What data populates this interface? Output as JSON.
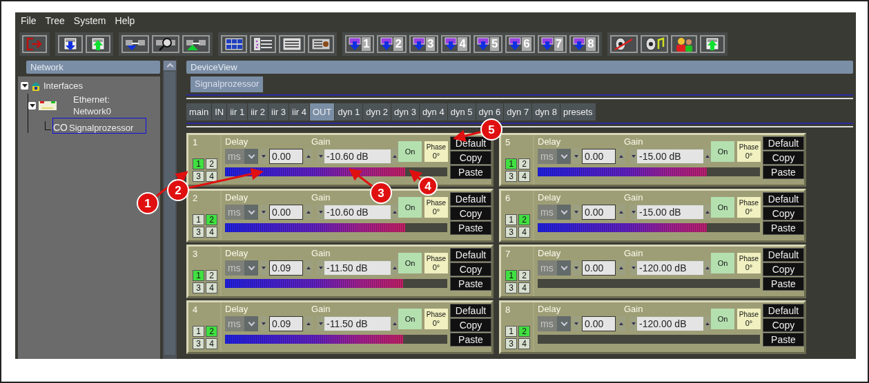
{
  "menu": [
    "File",
    "Tree",
    "System",
    "Help"
  ],
  "toolbar": [
    [
      {
        "kind": "exit"
      }
    ],
    [
      {
        "kind": "download"
      },
      {
        "kind": "upload"
      }
    ],
    [
      {
        "kind": "link-down"
      },
      {
        "kind": "link-search"
      },
      {
        "kind": "link-up"
      }
    ],
    [
      {
        "kind": "grid"
      },
      {
        "kind": "tree"
      },
      {
        "kind": "list"
      },
      {
        "kind": "device"
      }
    ],
    [
      {
        "kind": "preset",
        "label": "1"
      },
      {
        "kind": "preset",
        "label": "2"
      },
      {
        "kind": "preset",
        "label": "3"
      },
      {
        "kind": "preset",
        "label": "4"
      },
      {
        "kind": "preset",
        "label": "5"
      },
      {
        "kind": "preset",
        "label": "6"
      },
      {
        "kind": "preset",
        "label": "7"
      },
      {
        "kind": "preset",
        "label": "8"
      }
    ],
    [
      {
        "kind": "mute"
      },
      {
        "kind": "sound"
      },
      {
        "kind": "users"
      },
      {
        "kind": "upload"
      }
    ]
  ],
  "network": {
    "title": "Network",
    "tree": [
      {
        "label": "Interfaces",
        "kind": "house",
        "expanded": true,
        "selected": false,
        "children": [
          {
            "label": "Ethernet: Network0",
            "kind": "nic",
            "expanded": true,
            "selected": false,
            "children": [
              {
                "prefix": "CO",
                "label": "Signalprozessor",
                "kind": "device",
                "selected": true
              }
            ]
          }
        ]
      }
    ]
  },
  "device_view": {
    "title": "DeviceView",
    "device_tabs": [
      {
        "label": "Signalprozessor",
        "selected": true
      }
    ],
    "tabs": [
      {
        "label": "main",
        "selected": false
      },
      {
        "label": "IN",
        "selected": false
      },
      {
        "label": "iir 1",
        "selected": false
      },
      {
        "label": "iir 2",
        "selected": false
      },
      {
        "label": "iir 3",
        "selected": false
      },
      {
        "label": "iir 4",
        "selected": false
      },
      {
        "label": "OUT",
        "selected": true
      },
      {
        "label": "dyn 1",
        "selected": false
      },
      {
        "label": "dyn 2",
        "selected": false
      },
      {
        "label": "dyn 3",
        "selected": false
      },
      {
        "label": "dyn 4",
        "selected": false
      },
      {
        "label": "dyn 5",
        "selected": false
      },
      {
        "label": "dyn 6",
        "selected": false
      },
      {
        "label": "dyn 7",
        "selected": false
      },
      {
        "label": "dyn 8",
        "selected": false
      },
      {
        "label": "presets",
        "selected": false
      }
    ],
    "channels": [
      {
        "number": "1",
        "sources": [
          {
            "label": "1",
            "selected": true
          },
          {
            "label": "2",
            "selected": false
          },
          {
            "label": "3",
            "selected": false
          },
          {
            "label": "4",
            "selected": false
          }
        ],
        "delay_label": "Delay",
        "unit": "ms",
        "delay": "0.00",
        "gain_label": "Gain",
        "gain": "-10.60 dB",
        "on_label": "On",
        "on": true,
        "phase_label": "Phase",
        "phase": "0°",
        "level": 0.81,
        "buttons": [
          "Default",
          "Copy",
          "Paste"
        ]
      },
      {
        "number": "2",
        "sources": [
          {
            "label": "1",
            "selected": false
          },
          {
            "label": "2",
            "selected": true
          },
          {
            "label": "3",
            "selected": false
          },
          {
            "label": "4",
            "selected": false
          }
        ],
        "delay_label": "Delay",
        "unit": "ms",
        "delay": "0.00",
        "gain_label": "Gain",
        "gain": "-10.60 dB",
        "on_label": "On",
        "on": true,
        "phase_label": "Phase",
        "phase": "0°",
        "level": 0.81,
        "buttons": [
          "Default",
          "Copy",
          "Paste"
        ]
      },
      {
        "number": "3",
        "sources": [
          {
            "label": "1",
            "selected": true
          },
          {
            "label": "2",
            "selected": false
          },
          {
            "label": "3",
            "selected": false
          },
          {
            "label": "4",
            "selected": false
          }
        ],
        "delay_label": "Delay",
        "unit": "ms",
        "delay": "0.09",
        "gain_label": "Gain",
        "gain": "-11.50 dB",
        "on_label": "On",
        "on": true,
        "phase_label": "Phase",
        "phase": "0°",
        "level": 0.8,
        "buttons": [
          "Default",
          "Copy",
          "Paste"
        ]
      },
      {
        "number": "4",
        "sources": [
          {
            "label": "1",
            "selected": false
          },
          {
            "label": "2",
            "selected": true
          },
          {
            "label": "3",
            "selected": false
          },
          {
            "label": "4",
            "selected": false
          }
        ],
        "delay_label": "Delay",
        "unit": "ms",
        "delay": "0.09",
        "gain_label": "Gain",
        "gain": "-11.50 dB",
        "on_label": "On",
        "on": true,
        "phase_label": "Phase",
        "phase": "0°",
        "level": 0.8,
        "buttons": [
          "Default",
          "Copy",
          "Paste"
        ]
      },
      {
        "number": "5",
        "sources": [
          {
            "label": "1",
            "selected": true
          },
          {
            "label": "2",
            "selected": false
          },
          {
            "label": "3",
            "selected": false
          },
          {
            "label": "4",
            "selected": false
          }
        ],
        "delay_label": "Delay",
        "unit": "ms",
        "delay": "0.00",
        "gain_label": "Gain",
        "gain": "-15.00 dB",
        "on_label": "On",
        "on": true,
        "phase_label": "Phase",
        "phase": "0°",
        "level": 0.76,
        "buttons": [
          "Default",
          "Copy",
          "Paste"
        ]
      },
      {
        "number": "6",
        "sources": [
          {
            "label": "1",
            "selected": false
          },
          {
            "label": "2",
            "selected": true
          },
          {
            "label": "3",
            "selected": false
          },
          {
            "label": "4",
            "selected": false
          }
        ],
        "delay_label": "Delay",
        "unit": "ms",
        "delay": "0.00",
        "gain_label": "Gain",
        "gain": "-15.00 dB",
        "on_label": "On",
        "on": true,
        "phase_label": "Phase",
        "phase": "0°",
        "level": 0.76,
        "buttons": [
          "Default",
          "Copy",
          "Paste"
        ]
      },
      {
        "number": "7",
        "sources": [
          {
            "label": "1",
            "selected": true
          },
          {
            "label": "2",
            "selected": false
          },
          {
            "label": "3",
            "selected": false
          },
          {
            "label": "4",
            "selected": false
          }
        ],
        "delay_label": "Delay",
        "unit": "ms",
        "delay": "0.00",
        "gain_label": "Gain",
        "gain": "-120.00 dB",
        "on_label": "On",
        "on": true,
        "phase_label": "Phase",
        "phase": "0°",
        "level": 0,
        "buttons": [
          "Default",
          "Copy",
          "Paste"
        ]
      },
      {
        "number": "8",
        "sources": [
          {
            "label": "1",
            "selected": false
          },
          {
            "label": "2",
            "selected": true
          },
          {
            "label": "3",
            "selected": false
          },
          {
            "label": "4",
            "selected": false
          }
        ],
        "delay_label": "Delay",
        "unit": "ms",
        "delay": "0.00",
        "gain_label": "Gain",
        "gain": "-120.00 dB",
        "on_label": "On",
        "on": true,
        "phase_label": "Phase",
        "phase": "0°",
        "level": 0,
        "buttons": [
          "Default",
          "Copy",
          "Paste"
        ]
      }
    ]
  },
  "callouts": [
    "1",
    "2",
    "3",
    "4",
    "5"
  ]
}
